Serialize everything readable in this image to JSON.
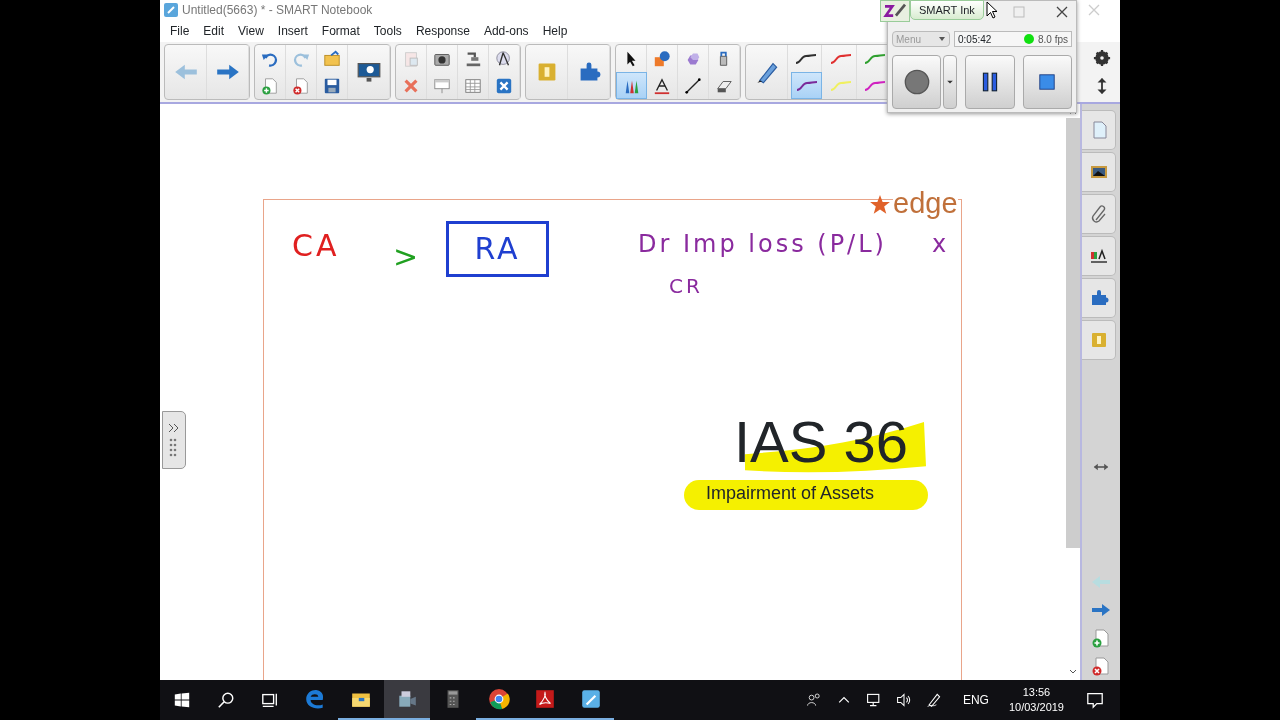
{
  "window": {
    "title": "Untitled(5663) * - SMART Notebook"
  },
  "menu": [
    "File",
    "Edit",
    "View",
    "Insert",
    "Format",
    "Tools",
    "Response",
    "Add-ons",
    "Help"
  ],
  "drawing_tools": [
    {
      "selected": false
    },
    {
      "selected": false
    },
    {
      "selected": false
    },
    {
      "selected": false
    },
    {
      "selected": true
    },
    {
      "selected": false
    },
    {
      "selected": false
    },
    {
      "selected": false
    }
  ],
  "pen_styles": [
    {
      "color": "#303030",
      "selected": false
    },
    {
      "color": "#e03030",
      "selected": false
    },
    {
      "color": "#30a030",
      "selected": false
    },
    {
      "color": "#7a2a9a",
      "selected": true
    },
    {
      "color": "#f0f060",
      "selected": false
    },
    {
      "color": "#d020c0",
      "selected": false
    }
  ],
  "recorder": {
    "title": "SMART Ink",
    "menu": "Menu",
    "time": "0:05:42",
    "fps": "8.0 fps",
    "recording": true
  },
  "canvas": {
    "ink": [
      {
        "text": "CA",
        "color": "#e02020",
        "kind": "plain"
      },
      {
        "text": ">",
        "color": "#20a020",
        "kind": "plain"
      },
      {
        "text": "RA",
        "color": "#1f3fd0",
        "kind": "boxed"
      },
      {
        "text": "Dr Imp loss (P/L)",
        "color": "#8a2a9e",
        "kind": "plain"
      },
      {
        "text": "x",
        "color": "#8a2a9e",
        "kind": "plain"
      },
      {
        "text": "CR",
        "color": "#8a2a9e",
        "kind": "plain"
      }
    ],
    "logo": "edge",
    "title": "IAS 36",
    "subtitle": "Impairment of Assets"
  },
  "taskbar": {
    "apps": [
      {
        "running": false,
        "selected": false
      },
      {
        "running": true,
        "selected": false
      },
      {
        "running": true,
        "selected": true
      },
      {
        "running": false,
        "selected": false
      },
      {
        "running": true,
        "selected": false
      },
      {
        "running": true,
        "selected": false
      },
      {
        "running": true,
        "selected": false
      }
    ],
    "language": "ENG",
    "time": "13:56",
    "date": "10/03/2019"
  }
}
